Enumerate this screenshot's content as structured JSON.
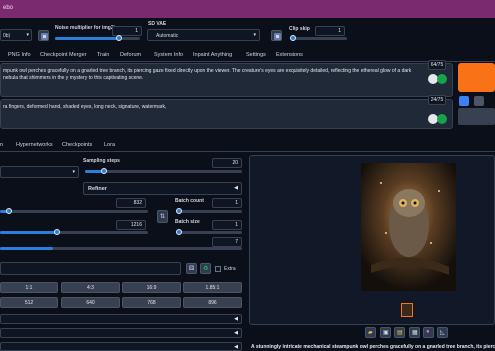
{
  "app": {
    "title": "ebo"
  },
  "model": {
    "value": "0b)"
  },
  "noise": {
    "label": "Noise multiplier for img2img",
    "value": "1",
    "fill": 0.75
  },
  "sd_vae": {
    "label": "SD VAE",
    "value": "Automatic"
  },
  "clip_skip": {
    "label": "Clip skip",
    "value": "1",
    "fill": 0.05
  },
  "main_tabs": [
    "PNG Info",
    "Checkpoint Merger",
    "Train",
    "Deforum",
    "System Info",
    "Inpaint Anything",
    "Settings",
    "Extensions"
  ],
  "prompt": {
    "text": "mpunk owl perches gracefully on a gnarled tree branch, its piercing gaze fixed directly upon the viewer. The creature's eyes are exquisitely detailed, reflecting the ethereal glow of a dark nebula that shimmers in the y mystery to this captivating scene.",
    "counter": "64/75"
  },
  "negative_prompt": {
    "text": "ra fingers, deformed hand, shaded eyes, long neck, signature, watermark,",
    "counter": "24/75"
  },
  "sub_tabs": [
    "n",
    "Hypernetworks",
    "Checkpoints",
    "Lora"
  ],
  "sampling_steps": {
    "label": "Sampling steps",
    "value": "20",
    "fill": 0.12
  },
  "refiner": {
    "label": "Refiner"
  },
  "width": {
    "value": "832",
    "fill": 0.04
  },
  "height": {
    "value": "1216",
    "fill": 0.4
  },
  "batch_count": {
    "label": "Batch count",
    "value": "1",
    "fill": 0.02
  },
  "batch_size": {
    "label": "Batch size",
    "value": "1",
    "fill": 0.02
  },
  "cfg": {
    "value": "7",
    "fill": 0.22
  },
  "extra": {
    "label": "Extra"
  },
  "aspect_buttons": [
    "1:1",
    "4:3",
    "16:9",
    "1.85:1",
    "2.39:1"
  ],
  "size_buttons": [
    "512",
    "640",
    "768",
    "896",
    "1024"
  ],
  "caption": "A stunningly intricate mechanical steampunk owl perches gracefully on a gnarled tree branch, its piercing gaze fixed",
  "icons": [
    "swap-icon",
    "dice-icon",
    "recycle-icon",
    "folder-icon",
    "save-icon",
    "zip-icon",
    "image-icon",
    "palette-icon",
    "ruler-icon"
  ],
  "colors": {
    "accent": "#2b7fd9",
    "generate": "#f97316",
    "topbar": "#7a2a6e",
    "background": "#0b0f19"
  }
}
